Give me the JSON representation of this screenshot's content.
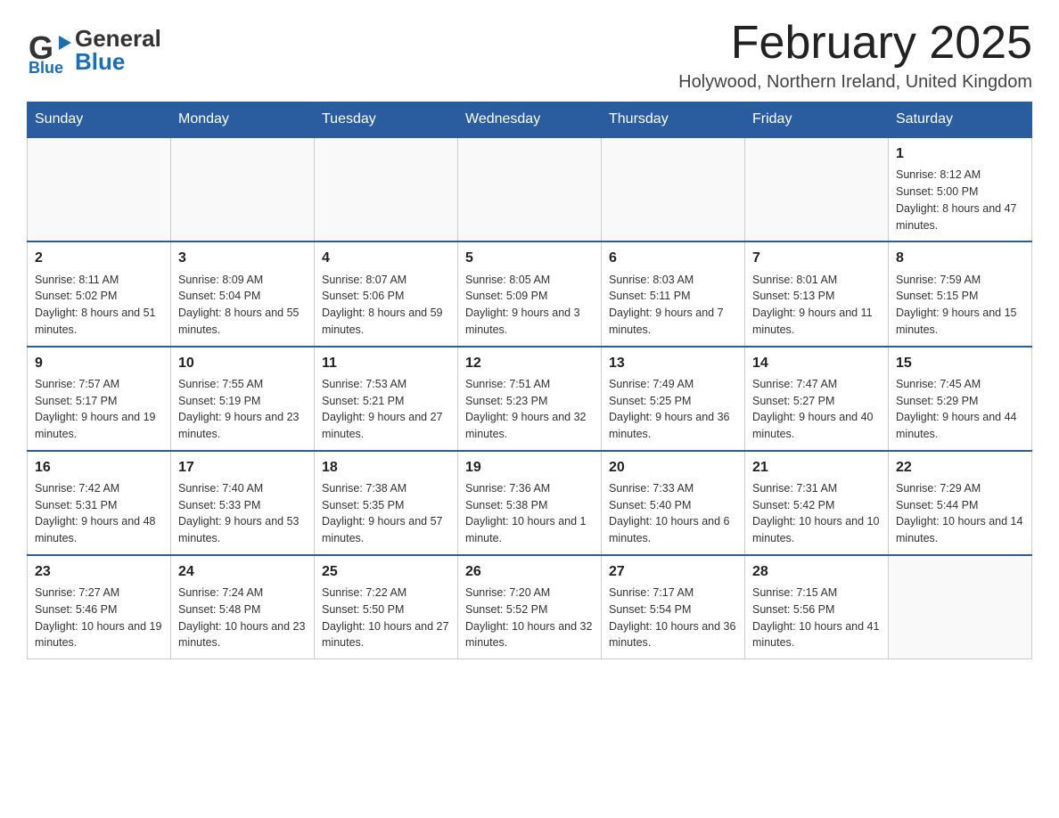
{
  "header": {
    "logo_general": "General",
    "logo_blue": "Blue",
    "month_title": "February 2025",
    "location": "Holywood, Northern Ireland, United Kingdom"
  },
  "weekdays": [
    "Sunday",
    "Monday",
    "Tuesday",
    "Wednesday",
    "Thursday",
    "Friday",
    "Saturday"
  ],
  "weeks": [
    [
      {
        "day": "",
        "info": ""
      },
      {
        "day": "",
        "info": ""
      },
      {
        "day": "",
        "info": ""
      },
      {
        "day": "",
        "info": ""
      },
      {
        "day": "",
        "info": ""
      },
      {
        "day": "",
        "info": ""
      },
      {
        "day": "1",
        "info": "Sunrise: 8:12 AM\nSunset: 5:00 PM\nDaylight: 8 hours and 47 minutes."
      }
    ],
    [
      {
        "day": "2",
        "info": "Sunrise: 8:11 AM\nSunset: 5:02 PM\nDaylight: 8 hours and 51 minutes."
      },
      {
        "day": "3",
        "info": "Sunrise: 8:09 AM\nSunset: 5:04 PM\nDaylight: 8 hours and 55 minutes."
      },
      {
        "day": "4",
        "info": "Sunrise: 8:07 AM\nSunset: 5:06 PM\nDaylight: 8 hours and 59 minutes."
      },
      {
        "day": "5",
        "info": "Sunrise: 8:05 AM\nSunset: 5:09 PM\nDaylight: 9 hours and 3 minutes."
      },
      {
        "day": "6",
        "info": "Sunrise: 8:03 AM\nSunset: 5:11 PM\nDaylight: 9 hours and 7 minutes."
      },
      {
        "day": "7",
        "info": "Sunrise: 8:01 AM\nSunset: 5:13 PM\nDaylight: 9 hours and 11 minutes."
      },
      {
        "day": "8",
        "info": "Sunrise: 7:59 AM\nSunset: 5:15 PM\nDaylight: 9 hours and 15 minutes."
      }
    ],
    [
      {
        "day": "9",
        "info": "Sunrise: 7:57 AM\nSunset: 5:17 PM\nDaylight: 9 hours and 19 minutes."
      },
      {
        "day": "10",
        "info": "Sunrise: 7:55 AM\nSunset: 5:19 PM\nDaylight: 9 hours and 23 minutes."
      },
      {
        "day": "11",
        "info": "Sunrise: 7:53 AM\nSunset: 5:21 PM\nDaylight: 9 hours and 27 minutes."
      },
      {
        "day": "12",
        "info": "Sunrise: 7:51 AM\nSunset: 5:23 PM\nDaylight: 9 hours and 32 minutes."
      },
      {
        "day": "13",
        "info": "Sunrise: 7:49 AM\nSunset: 5:25 PM\nDaylight: 9 hours and 36 minutes."
      },
      {
        "day": "14",
        "info": "Sunrise: 7:47 AM\nSunset: 5:27 PM\nDaylight: 9 hours and 40 minutes."
      },
      {
        "day": "15",
        "info": "Sunrise: 7:45 AM\nSunset: 5:29 PM\nDaylight: 9 hours and 44 minutes."
      }
    ],
    [
      {
        "day": "16",
        "info": "Sunrise: 7:42 AM\nSunset: 5:31 PM\nDaylight: 9 hours and 48 minutes."
      },
      {
        "day": "17",
        "info": "Sunrise: 7:40 AM\nSunset: 5:33 PM\nDaylight: 9 hours and 53 minutes."
      },
      {
        "day": "18",
        "info": "Sunrise: 7:38 AM\nSunset: 5:35 PM\nDaylight: 9 hours and 57 minutes."
      },
      {
        "day": "19",
        "info": "Sunrise: 7:36 AM\nSunset: 5:38 PM\nDaylight: 10 hours and 1 minute."
      },
      {
        "day": "20",
        "info": "Sunrise: 7:33 AM\nSunset: 5:40 PM\nDaylight: 10 hours and 6 minutes."
      },
      {
        "day": "21",
        "info": "Sunrise: 7:31 AM\nSunset: 5:42 PM\nDaylight: 10 hours and 10 minutes."
      },
      {
        "day": "22",
        "info": "Sunrise: 7:29 AM\nSunset: 5:44 PM\nDaylight: 10 hours and 14 minutes."
      }
    ],
    [
      {
        "day": "23",
        "info": "Sunrise: 7:27 AM\nSunset: 5:46 PM\nDaylight: 10 hours and 19 minutes."
      },
      {
        "day": "24",
        "info": "Sunrise: 7:24 AM\nSunset: 5:48 PM\nDaylight: 10 hours and 23 minutes."
      },
      {
        "day": "25",
        "info": "Sunrise: 7:22 AM\nSunset: 5:50 PM\nDaylight: 10 hours and 27 minutes."
      },
      {
        "day": "26",
        "info": "Sunrise: 7:20 AM\nSunset: 5:52 PM\nDaylight: 10 hours and 32 minutes."
      },
      {
        "day": "27",
        "info": "Sunrise: 7:17 AM\nSunset: 5:54 PM\nDaylight: 10 hours and 36 minutes."
      },
      {
        "day": "28",
        "info": "Sunrise: 7:15 AM\nSunset: 5:56 PM\nDaylight: 10 hours and 41 minutes."
      },
      {
        "day": "",
        "info": ""
      }
    ]
  ]
}
